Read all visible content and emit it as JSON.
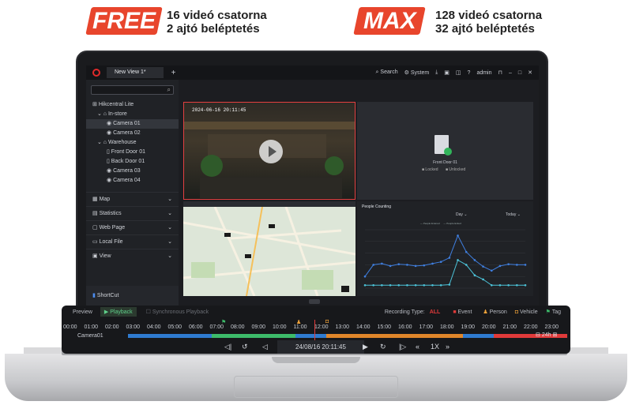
{
  "promo": {
    "free_badge": "FREE",
    "free_line1": "16 videó csatorna",
    "free_line2": "2 ajtó beléptetés",
    "max_badge": "MAX",
    "max_line1": "128 videó csatorna",
    "max_line2": "32 ajtó beléptetés"
  },
  "titlebar": {
    "tab": "New View 1*",
    "search": "Search",
    "system": "System",
    "user": "admin"
  },
  "sidebar": {
    "search_placeholder": "Search",
    "root": "Hikcentral Lite",
    "group1": "In-store",
    "group1_items": [
      "Camera 01",
      "Camera 02"
    ],
    "group2": "Warehouse",
    "group2_items": [
      "Front Door 01",
      "Back Door 01",
      "Camera 03",
      "Camera 04"
    ],
    "menus": [
      "Map",
      "Statistics",
      "Web Page",
      "Local File",
      "View"
    ],
    "shortcut": "ShortCut"
  },
  "video": {
    "timestamp": "2024-06-16 20:11:45"
  },
  "door": {
    "name": "Front Door 01",
    "locked": "Locked",
    "unlocked": "Unlocked"
  },
  "chart_data": {
    "type": "line",
    "title": "People Counting",
    "dropdown_1": "Day",
    "dropdown_2": "Today",
    "legend": [
      "People Entered",
      "People Exited"
    ],
    "colors": [
      "#3f7fe0",
      "#4cc3d9"
    ],
    "series": [
      {
        "name": "People Entered",
        "values": [
          20,
          40,
          42,
          38,
          41,
          40,
          38,
          39,
          42,
          45,
          52,
          90,
          62,
          48,
          37,
          30,
          38,
          41,
          40,
          40
        ]
      },
      {
        "name": "People Exited",
        "values": [
          5,
          5,
          5,
          5,
          5,
          5,
          5,
          5,
          5,
          5,
          6,
          48,
          40,
          22,
          15,
          5,
          5,
          5,
          5,
          5
        ]
      }
    ],
    "ylim": [
      0,
      100
    ]
  },
  "playback": {
    "preview": "Preview",
    "playback": "Playback",
    "sync": "Synchronous Playback",
    "recording_type": "Recording Type:",
    "all": "ALL",
    "event": "Event",
    "person": "Person",
    "vehicle": "Vehicle",
    "tag": "Tag",
    "camera": "Camera01",
    "time": "24/08/16 20:11:45",
    "speed": "1X",
    "range": "24h",
    "hours": [
      "00:00",
      "01:00",
      "02:00",
      "03:00",
      "04:00",
      "05:00",
      "06:00",
      "07:00",
      "08:00",
      "09:00",
      "10:00",
      "11:00",
      "12:00",
      "13:00",
      "14:00",
      "15:00",
      "16:00",
      "17:00",
      "18:00",
      "19:00",
      "20:00",
      "21:00",
      "22:00",
      "23:00"
    ]
  },
  "colors": {
    "accent": "#e8452c",
    "recording_blue": "#2f7bd0",
    "recording_orange": "#e0862a",
    "recording_green": "#3dbb6a",
    "alarm_red": "#e03a3a"
  }
}
